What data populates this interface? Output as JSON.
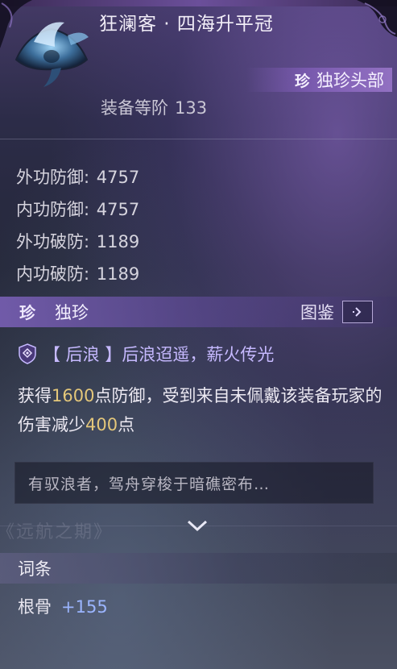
{
  "item": {
    "name": "狂澜客 · 四海升平冠",
    "rarity_icon": "珍",
    "rarity_label": "独珍头部",
    "gear_level_label": "装备等阶",
    "gear_level_value": "133"
  },
  "stats": [
    {
      "label": "外功防御:",
      "value": "4757"
    },
    {
      "label": "内功防御:",
      "value": "4757"
    },
    {
      "label": "外功破防:",
      "value": "1189"
    },
    {
      "label": "内功破防:",
      "value": "1189"
    }
  ],
  "unique_section": {
    "icon": "珍",
    "label": "独珍",
    "catalog_label": "图鉴"
  },
  "skill": {
    "title": "【 后浪 】后浪迢遥，薪火传光",
    "desc_part1": "获得",
    "desc_num1": "1600",
    "desc_part2": "点防御，受到来自未佩戴该装备玩家的伤害减少",
    "desc_num2": "400",
    "desc_part3": "点"
  },
  "lore": {
    "text": "有驭浪者，驾舟穿梭于暗礁密布…",
    "watermark": "《远航之期》"
  },
  "attributes_section": {
    "label": "词条",
    "rows": [
      {
        "label": "根骨",
        "value": "+155"
      }
    ]
  },
  "colors": {
    "highlight_number": "#e4c77a",
    "skill_title": "#c6b9ff",
    "attr_value": "#9bb5ff"
  }
}
